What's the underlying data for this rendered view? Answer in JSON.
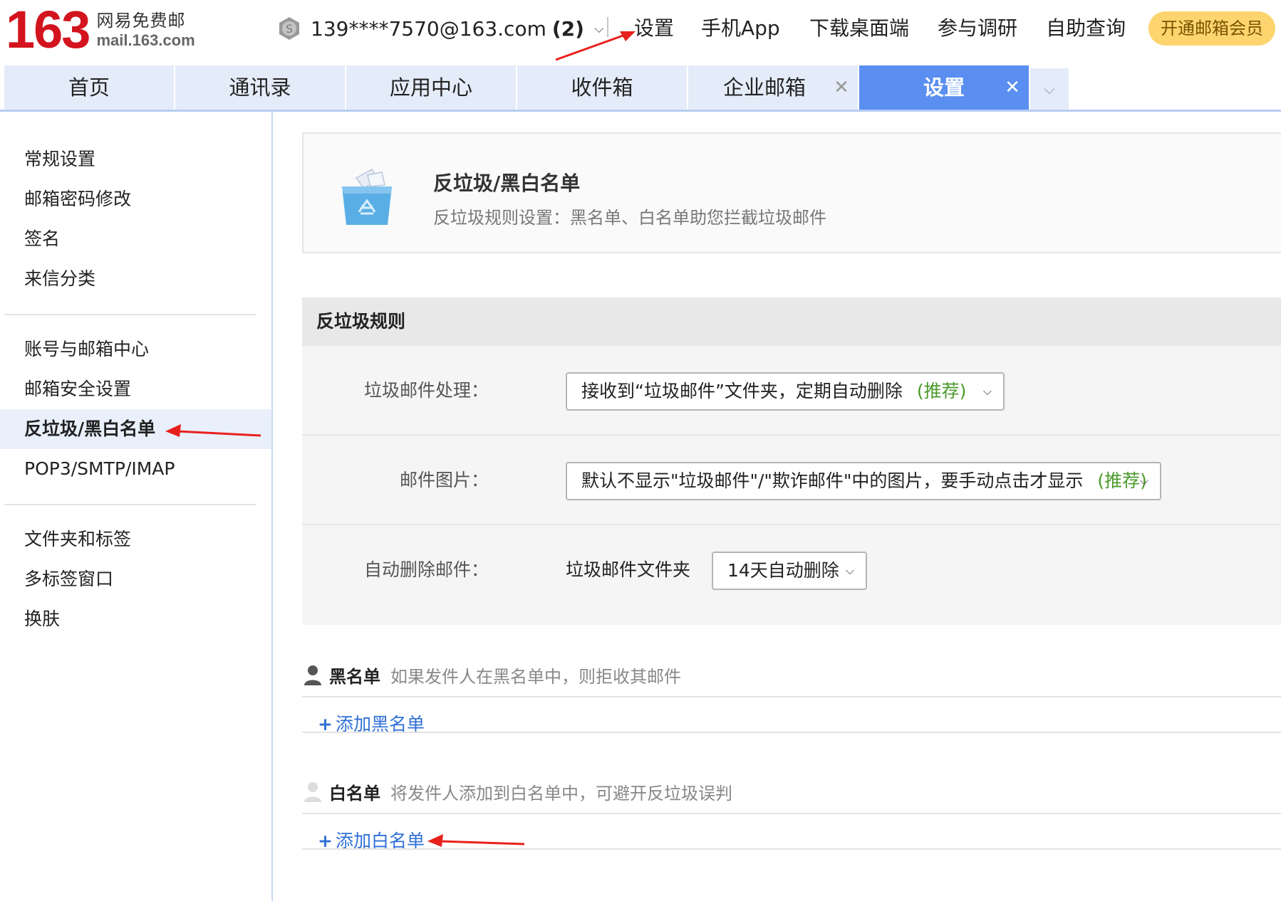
{
  "logo": {
    "number": "163",
    "cn": "网易免费邮",
    "domain": "mail.163.com"
  },
  "account": {
    "email": "139****7570@163.com",
    "count": "(2)",
    "icon": "coin-icon"
  },
  "topnav": [
    "设置",
    "手机App",
    "下载桌面端",
    "参与调研",
    "自助查询"
  ],
  "vip_button": "开通邮箱会员",
  "tabs": [
    {
      "label": "首页"
    },
    {
      "label": "通讯录"
    },
    {
      "label": "应用中心"
    },
    {
      "label": "收件箱"
    },
    {
      "label": "企业邮箱"
    },
    {
      "label": "设置"
    }
  ],
  "sidebar": {
    "group1": [
      "常规设置",
      "邮箱密码修改",
      "签名",
      "来信分类"
    ],
    "group2": [
      "账号与邮箱中心",
      "邮箱安全设置",
      "反垃圾/黑白名单",
      "POP3/SMTP/IMAP"
    ],
    "group3": [
      "文件夹和标签",
      "多标签窗口",
      "换肤"
    ],
    "active": "反垃圾/黑白名单"
  },
  "intro": {
    "title": "反垃圾/黑白名单",
    "desc": "反垃圾规则设置：黑名单、白名单助您拦截垃圾邮件",
    "icon": "recycle-bin-icon"
  },
  "rules": {
    "heading": "反垃圾规则",
    "junk_label": "垃圾邮件处理：",
    "junk_value": "接收到“垃圾邮件”文件夹，定期自动删除",
    "junk_rec": "(推荐)",
    "image_label": "邮件图片：",
    "image_value": "默认不显示\"垃圾邮件\"/\"欺诈邮件\"中的图片，要手动点击才显示",
    "image_rec": "(推荐)",
    "delete_label": "自动删除邮件：",
    "delete_folder": "垃圾邮件文件夹",
    "delete_value": "14天自动删除"
  },
  "blacklist": {
    "title": "黑名单",
    "desc": "如果发件人在黑名单中，则拒收其邮件",
    "add": "添加黑名单"
  },
  "whitelist": {
    "title": "白名单",
    "desc": "将发件人添加到白名单中，可避开反垃圾误判",
    "add": "添加白名单"
  },
  "colors": {
    "brand_red": "#d3141e",
    "tab_active": "#5a8ef0",
    "tab_bg": "#e4ecf9",
    "vip": "#fdd46e",
    "link": "#2f6fd6",
    "recommend": "#4a9a2a",
    "annotation_arrow": "#e8201c"
  }
}
